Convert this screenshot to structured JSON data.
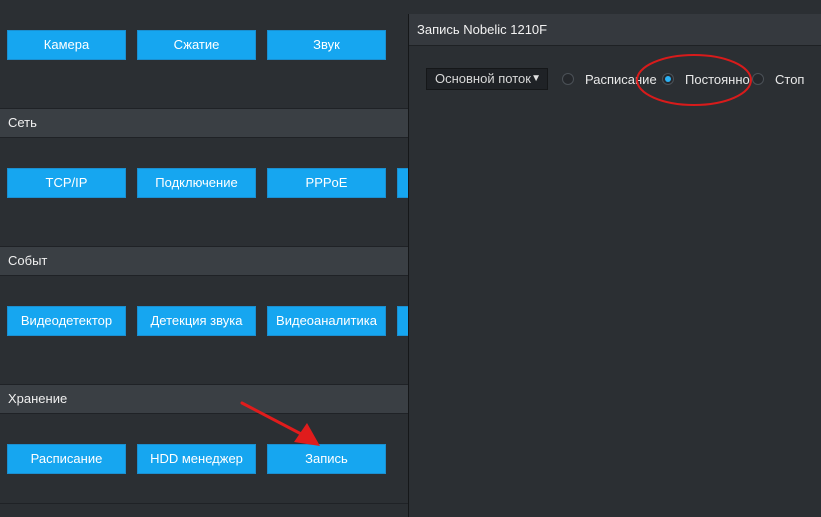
{
  "left": {
    "row1": {
      "buttons": [
        "Камера",
        "Сжатие",
        "Звук"
      ]
    },
    "network": {
      "header": "Сеть",
      "buttons": [
        "TCP/IP",
        "Подключение",
        "PPPoE",
        ""
      ]
    },
    "events": {
      "header": "Событ",
      "buttons": [
        "Видеодетектор",
        "Детекция звука",
        "Видеоаналитика",
        ""
      ]
    },
    "storage": {
      "header": "Хранение",
      "buttons": [
        "Расписание",
        "HDD менеджер",
        "Запись"
      ]
    }
  },
  "record": {
    "title": "Запись Nobelic 1210F",
    "stream": "Основной поток",
    "modes": [
      "Расписание",
      "Постоянно",
      "Стоп"
    ],
    "selected_mode": "Постоянно"
  },
  "colors": {
    "button": "#16a6f0",
    "annotation": "#e01c1c"
  },
  "icons": {
    "caret": "caret-down-icon",
    "arrow": "red-arrow-annotation",
    "circle": "red-circle-annotation"
  }
}
